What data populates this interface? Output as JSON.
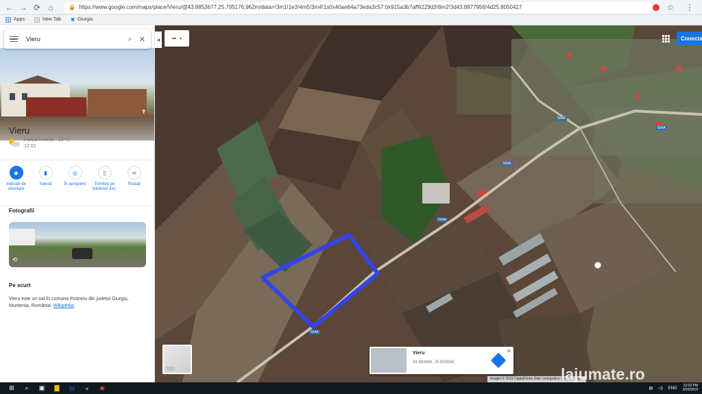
{
  "browser": {
    "url": "https://www.google.com/maps/place/Vieru/@43.8853677,25.795176,962m/data=!3m1!1e3!4m5!3m4!1s0x40ae64a73eda3c57:0x915a3b7aff6229d3!8m2!3d43.8877956!4d25.8050427",
    "bookmarks": [
      {
        "label": "Apps"
      },
      {
        "label": "New Tab"
      },
      {
        "label": "Giurgiu"
      }
    ]
  },
  "panel": {
    "search_value": "Vieru",
    "place_title": "Vieru",
    "weather_line1": "Parțial înnorat · 12 °C",
    "weather_line2": "12:02",
    "actions": [
      {
        "label": "Indicații de orientare",
        "icon": "directions-icon"
      },
      {
        "label": "Salvați",
        "icon": "bookmark-icon"
      },
      {
        "label": "În apropiere",
        "icon": "nearby-icon"
      },
      {
        "label": "Trimiteți pe telefonul dvs.",
        "icon": "phone-icon"
      },
      {
        "label": "Postați",
        "icon": "share-icon"
      }
    ],
    "photos_heading": "Fotografii",
    "summary_heading": "Pe scurt",
    "summary_text": "Vieru este un sat în comuna Putineiu din județul Giurgiu, Muntenia, România.",
    "summary_link": "Wikipedia"
  },
  "map": {
    "connect_label": "Conecta",
    "minimap_label": "Hartă",
    "road_labels": [
      "504A",
      "504A",
      "504A",
      "504A",
      "504A"
    ],
    "card": {
      "name": "Vieru",
      "coords": "43.883866, 25.803088"
    },
    "copyright": "Imagini © 2019 DigitalGlobe,Date cartografice ©2019 Google",
    "watermark": "lajumate.ro"
  },
  "taskbar": {
    "lang": "ENG",
    "time": "12:02 PM",
    "date": "3/20/2019"
  }
}
